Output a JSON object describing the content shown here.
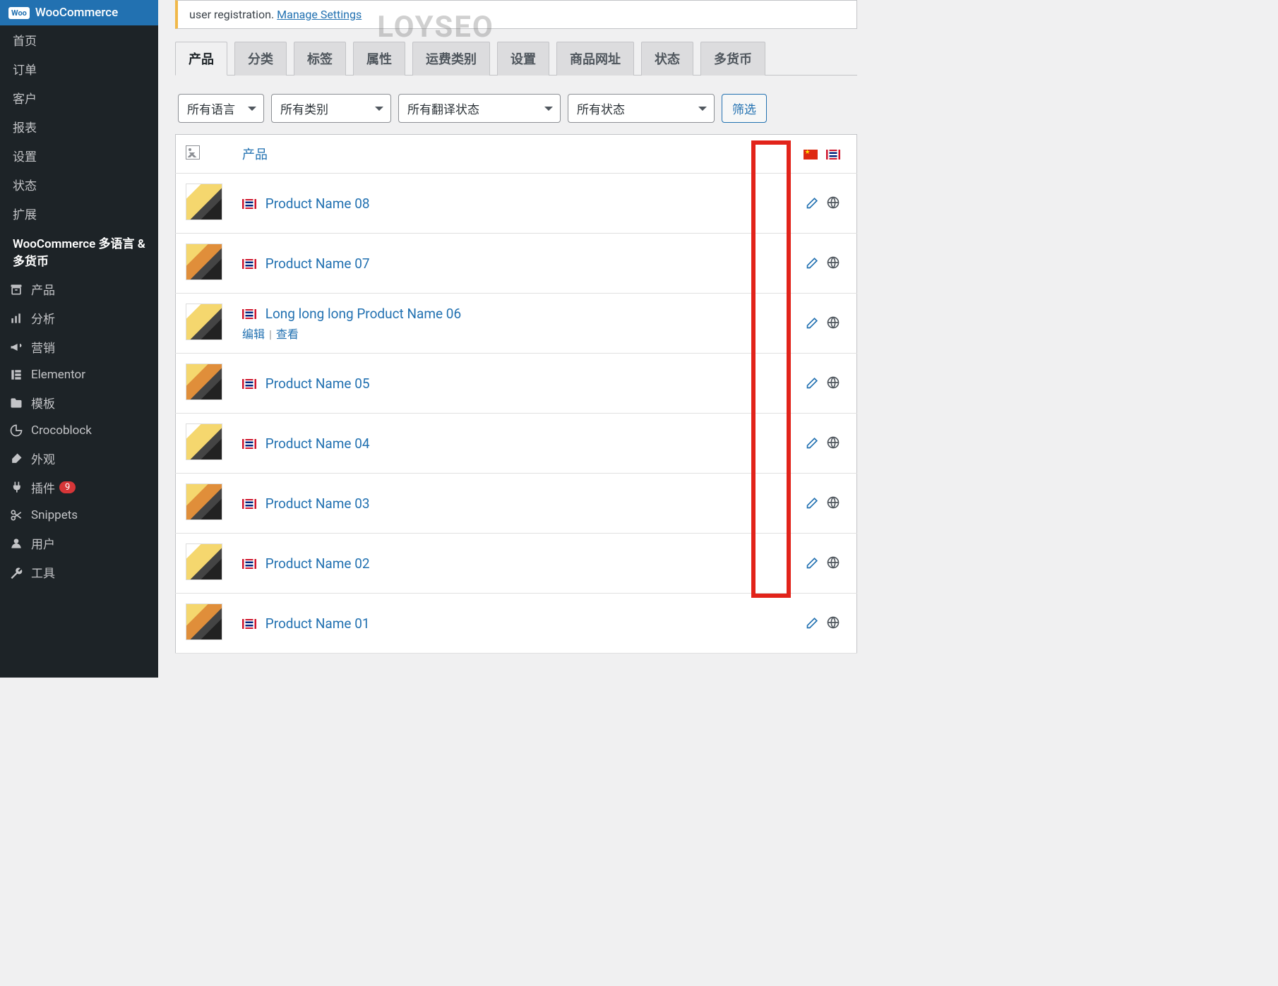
{
  "watermark": "LOYSEO",
  "notice": {
    "text_prefix": "user registration. ",
    "link": "Manage Settings"
  },
  "sidebar": {
    "current": "WooCommerce",
    "subs": [
      "首页",
      "订单",
      "客户",
      "报表",
      "设置",
      "状态",
      "扩展",
      "WooCommerce 多语言 & 多货币"
    ],
    "items": [
      {
        "label": "产品",
        "icon": "archive"
      },
      {
        "label": "分析",
        "icon": "chart"
      },
      {
        "label": "营销",
        "icon": "megaphone"
      },
      {
        "label": "Elementor",
        "icon": "elementor"
      },
      {
        "label": "模板",
        "icon": "folder"
      },
      {
        "label": "Crocoblock",
        "icon": "croco"
      },
      {
        "label": "外观",
        "icon": "brush"
      },
      {
        "label": "插件",
        "icon": "plug",
        "badge": "9"
      },
      {
        "label": "Snippets",
        "icon": "scissors"
      },
      {
        "label": "用户",
        "icon": "user"
      },
      {
        "label": "工具",
        "icon": "wrench"
      }
    ]
  },
  "tabs": [
    "产品",
    "分类",
    "标签",
    "属性",
    "运费类别",
    "设置",
    "商品网址",
    "状态",
    "多货币"
  ],
  "active_tab": "产品",
  "filters": {
    "lang": "所有语言",
    "category": "所有类别",
    "trans_status": "所有翻译状态",
    "status": "所有状态",
    "button": "筛选"
  },
  "table": {
    "header_product": "产品",
    "lang_flags": [
      "cn",
      "uk"
    ],
    "row_actions": {
      "edit": "编辑",
      "view": "查看"
    },
    "rows": [
      {
        "name": "Product Name 08",
        "flag": "uk",
        "thumb": "alt"
      },
      {
        "name": "Product Name 07",
        "flag": "uk",
        "thumb": ""
      },
      {
        "name": "Long long long Product Name 06",
        "flag": "uk",
        "thumb": "alt",
        "show_actions": true
      },
      {
        "name": "Product Name 05",
        "flag": "uk",
        "thumb": ""
      },
      {
        "name": "Product Name 04",
        "flag": "uk",
        "thumb": "alt"
      },
      {
        "name": "Product Name 03",
        "flag": "uk",
        "thumb": ""
      },
      {
        "name": "Product Name 02",
        "flag": "uk",
        "thumb": "alt"
      },
      {
        "name": "Product Name 01",
        "flag": "uk",
        "thumb": ""
      }
    ]
  }
}
